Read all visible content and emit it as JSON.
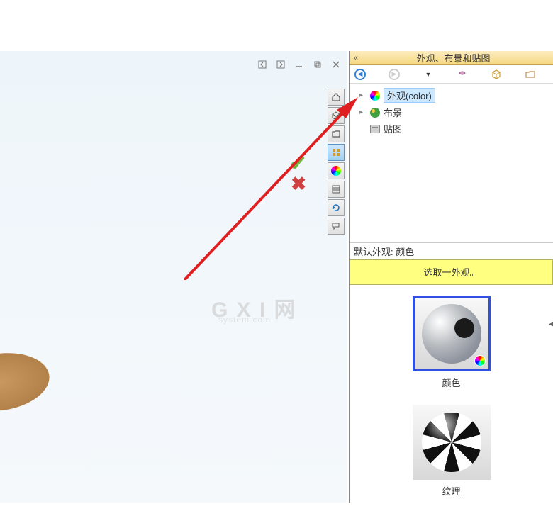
{
  "panel": {
    "title": "外观、布景和贴图",
    "collapse": "«"
  },
  "tree": {
    "appearance_label": "外观(color)",
    "scene_label": "布景",
    "decal_label": "贴图"
  },
  "default_appearance": {
    "label": "默认外观: 颜色",
    "prompt": "选取一外观。"
  },
  "previews": {
    "color_label": "颜色",
    "texture_label": "纹理"
  },
  "watermark": {
    "main": "X I 网",
    "sub": "system.com"
  }
}
